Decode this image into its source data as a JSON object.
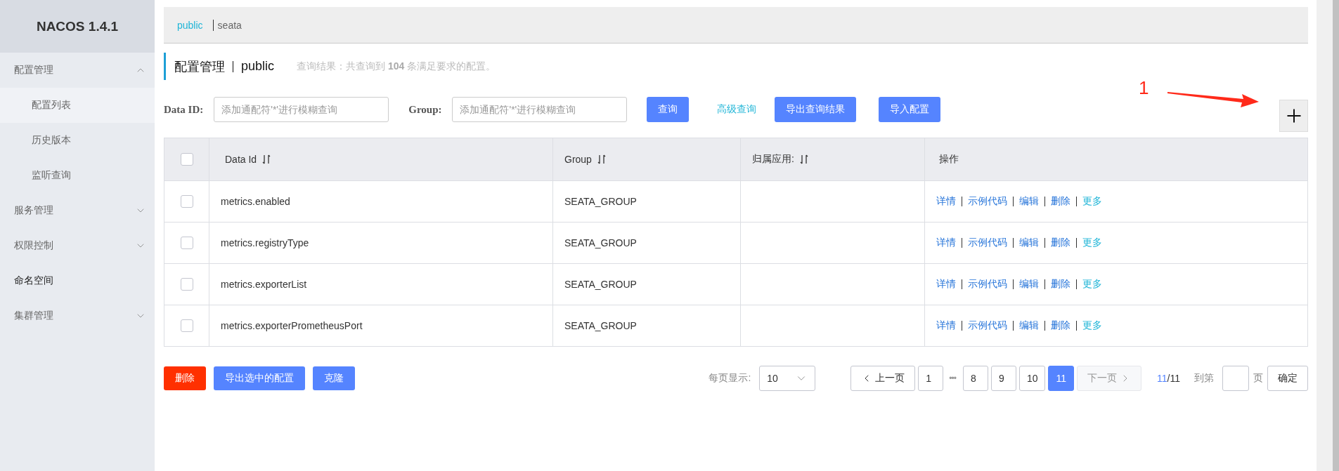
{
  "sidebar": {
    "title": "NACOS 1.4.1",
    "items": [
      {
        "label": "配置管理",
        "kind": "group",
        "expanded": true,
        "children": [
          {
            "label": "配置列表",
            "selected": true
          },
          {
            "label": "历史版本",
            "selected": false
          },
          {
            "label": "监听查询",
            "selected": false
          }
        ]
      },
      {
        "label": "服务管理",
        "kind": "group",
        "expanded": false
      },
      {
        "label": "权限控制",
        "kind": "group",
        "expanded": false
      },
      {
        "label": "命名空间",
        "kind": "link"
      },
      {
        "label": "集群管理",
        "kind": "group",
        "expanded": false
      }
    ]
  },
  "namespaces": [
    {
      "label": "public",
      "selected": true
    },
    {
      "label": "seata",
      "selected": false
    }
  ],
  "page_title": {
    "section": "配置管理",
    "namespace": "public",
    "summary": "查询结果：共查询到 **104** 条满足要求的配置。"
  },
  "filters": [
    {
      "label": "Data ID:",
      "placeholder": "添加通配符'*'进行模糊查询"
    },
    {
      "label": "Group:",
      "placeholder": "添加通配符'*'进行模糊查询"
    }
  ],
  "search_actions": [
    {
      "label": "查询",
      "kind": "primary"
    },
    {
      "label": "高级查询",
      "kind": "link"
    },
    {
      "label": "导出查询结果",
      "kind": "primary"
    },
    {
      "label": "导入配置",
      "kind": "primary"
    }
  ],
  "annotation": {
    "label": "1"
  },
  "table": {
    "select_all_checked": false,
    "columns": [
      {
        "label": "Data Id",
        "sortable": true
      },
      {
        "label": "Group",
        "sortable": true
      },
      {
        "label": "归属应用:",
        "sortable": true
      },
      {
        "label": "操作",
        "sortable": false
      }
    ],
    "rows": [
      {
        "checked": false,
        "data_id": "metrics.enabled",
        "group": "SEATA_GROUP",
        "actions": [
          {
            "label": "详情",
            "kind": "link"
          },
          {
            "label": "示例代码",
            "kind": "link"
          },
          {
            "label": "编辑",
            "kind": "link"
          },
          {
            "label": "删除",
            "kind": "link"
          },
          {
            "label": "更多",
            "kind": "more"
          }
        ]
      },
      {
        "checked": false,
        "data_id": "metrics.registryType",
        "group": "SEATA_GROUP",
        "actions": [
          {
            "label": "详情",
            "kind": "link"
          },
          {
            "label": "示例代码",
            "kind": "link"
          },
          {
            "label": "编辑",
            "kind": "link"
          },
          {
            "label": "删除",
            "kind": "link"
          },
          {
            "label": "更多",
            "kind": "more"
          }
        ]
      },
      {
        "checked": false,
        "data_id": "metrics.exporterList",
        "group": "SEATA_GROUP",
        "actions": [
          {
            "label": "详情",
            "kind": "link"
          },
          {
            "label": "示例代码",
            "kind": "link"
          },
          {
            "label": "编辑",
            "kind": "link"
          },
          {
            "label": "删除",
            "kind": "link"
          },
          {
            "label": "更多",
            "kind": "more"
          }
        ]
      },
      {
        "checked": false,
        "data_id": "metrics.exporterPrometheusPort",
        "group": "SEATA_GROUP",
        "actions": [
          {
            "label": "详情",
            "kind": "link"
          },
          {
            "label": "示例代码",
            "kind": "link"
          },
          {
            "label": "编辑",
            "kind": "link"
          },
          {
            "label": "删除",
            "kind": "link"
          },
          {
            "label": "更多",
            "kind": "more"
          }
        ]
      }
    ]
  },
  "bulk_actions": [
    {
      "label": "删除",
      "kind": "danger"
    },
    {
      "label": "导出选中的配置",
      "kind": "primary"
    },
    {
      "label": "克隆",
      "kind": "primary"
    }
  ],
  "pagination": {
    "page_size_label": "每页显示:",
    "page_size": "10",
    "prev": {
      "label": "上一页",
      "disabled": false
    },
    "pages": [
      {
        "kind": "page",
        "label": "1",
        "selected": false
      },
      {
        "kind": "ellipsis",
        "label": "•••"
      },
      {
        "kind": "page",
        "label": "8",
        "selected": false
      },
      {
        "kind": "page",
        "label": "9",
        "selected": false
      },
      {
        "kind": "page",
        "label": "10",
        "selected": false
      },
      {
        "kind": "page",
        "label": "11",
        "selected": true
      }
    ],
    "next": {
      "label": "下一页",
      "disabled": true
    },
    "current": "11",
    "total": "/11",
    "jump_label": "到第",
    "jump_unit": "页",
    "confirm": "确定"
  }
}
